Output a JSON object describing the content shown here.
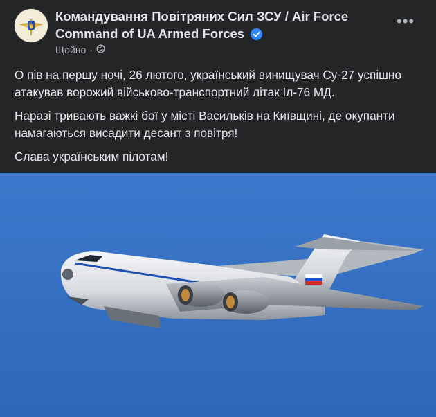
{
  "post": {
    "author": "Командування Повітряних Сил ЗСУ / Air Force Command of UA Armed Forces",
    "timestamp": "Щойно",
    "privacy_icon": "globe-icon",
    "verified_icon": "verified-badge-icon",
    "more_icon": "more-options-icon",
    "paragraphs": [
      "О пів на першу ночі, 26 лютого, український винищувач Су-27 успішно атакував ворожий військово-транспортний літак Іл-76 МД.",
      "Наразі тривають важкі бої у місті Васильків на Київщині, де окупанти намагаються висадити десант з повітря!",
      "Слава українським пілотам!"
    ]
  },
  "colors": {
    "background": "#242526",
    "text": "#e4e6eb",
    "secondary_text": "#b0b3b8",
    "verified_blue": "#2d88ff",
    "sky": "#3a74c8"
  }
}
